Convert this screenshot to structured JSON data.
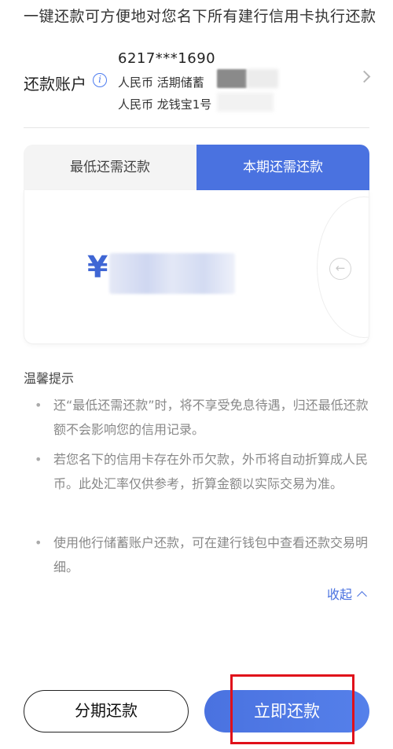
{
  "intro_text": "一键还款可方便地对您名下所有建行信用卡执行还款",
  "account": {
    "label": "还款账户",
    "info_icon_glyph": "i",
    "card_number": "6217***1690",
    "line1": "人民币 活期储蓄",
    "line2": "人民币 龙钱宝1号"
  },
  "tabs": [
    {
      "label": "最低还需还款",
      "selected": false
    },
    {
      "label": "本期还需还款",
      "selected": true
    }
  ],
  "amount": {
    "currency_symbol": "¥",
    "back_icon_glyph": "←"
  },
  "tips": {
    "title": "温馨提示",
    "items": [
      "还“最低还需还款”时，将不享受免息待遇，归还最低还款额不会影响您的信用记录。",
      "若您名下的信用卡存在外币欠款，外币将自动折算成人民币。此处汇率仅供参考，折算金额以实际交易为准。",
      "使用他行储蓄账户还款，可在建行钱包中查看还款交易明细。"
    ]
  },
  "collapse_label": "收起",
  "buttons": {
    "installment": "分期还款",
    "pay_now": "立即还款"
  },
  "colors": {
    "accent": "#4a72e0",
    "highlight": "#e0101a"
  },
  "icons": [
    "info-icon",
    "chevron-right-icon",
    "back-arrow-icon",
    "chevron-up-icon"
  ]
}
